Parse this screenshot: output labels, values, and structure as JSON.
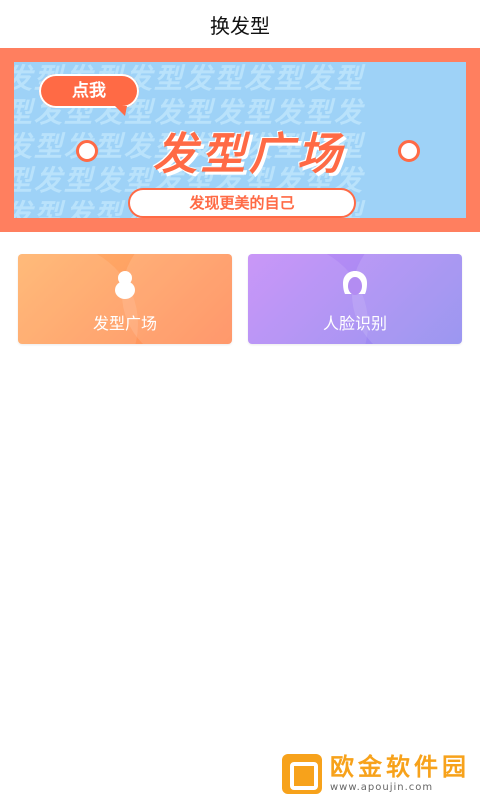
{
  "header": {
    "title": "换发型"
  },
  "banner": {
    "bubble_label": "点我",
    "main_text": "发型广场",
    "pill_text": "发现更美的自己",
    "pattern_rows": [
      "发型发型发型发型发型发型",
      "型发型发型发型发型发型发",
      "发型发型发型发型发型发型",
      "型发型发型发型发型发型发",
      "发型发型发型发型发型发型"
    ],
    "colors": {
      "border": "#ff7f5f",
      "sky": "#9ed2f7",
      "accent": "#ff6a45"
    }
  },
  "cards": [
    {
      "label": "发型广场",
      "icon": "hair-bun-icon",
      "color_start": "#ffb36b",
      "color_end": "#ff8a58"
    },
    {
      "label": "人脸识别",
      "icon": "face-icon",
      "color_start": "#c48cf7",
      "color_end": "#8e89ef"
    }
  ],
  "watermark": {
    "title": "欧金软件园",
    "subtitle": "www.apoujin.com"
  }
}
